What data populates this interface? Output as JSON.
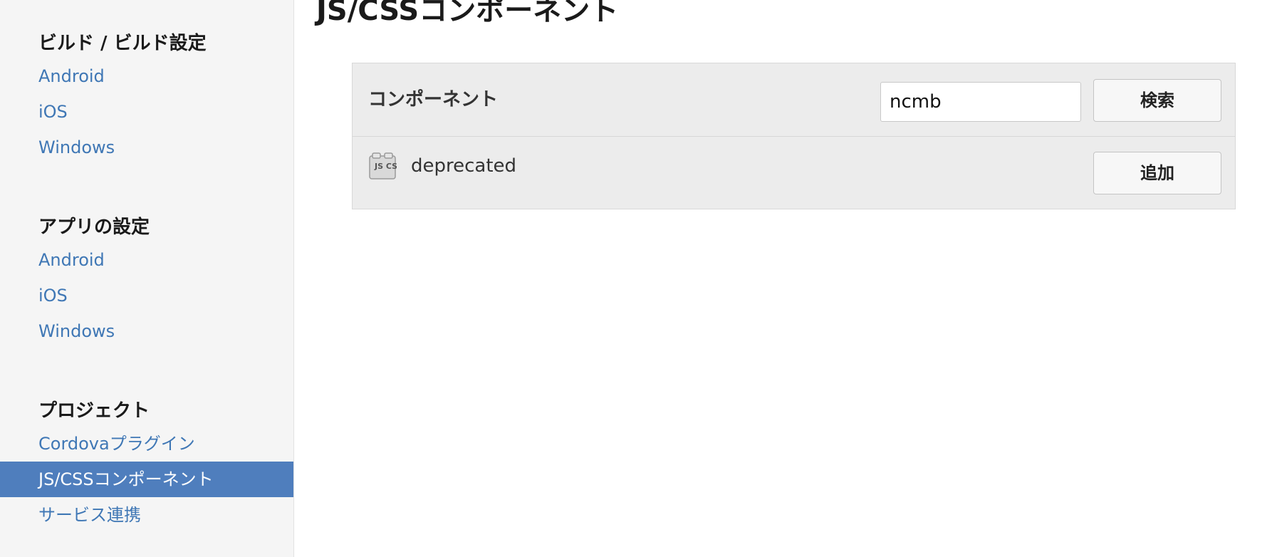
{
  "page": {
    "title": "JS/CSSコンポーネント"
  },
  "sidebar": {
    "sections": [
      {
        "title": "ビルド / ビルド設定",
        "items": [
          "Android",
          "iOS",
          "Windows"
        ]
      },
      {
        "title": "アプリの設定",
        "items": [
          "Android",
          "iOS",
          "Windows"
        ]
      },
      {
        "title": "プロジェクト",
        "items": [
          "Cordovaプラグイン",
          "JS/CSSコンポーネント",
          "サービス連携"
        ]
      }
    ],
    "active_item": "JS/CSSコンポーネント"
  },
  "components_panel": {
    "header_label": "コンポーネント",
    "search_value": "ncmb",
    "search_button": "検索",
    "results": [
      {
        "icon": "js-css-icon",
        "icon_text": "JS CSS",
        "name": "deprecated",
        "add_button": "追加"
      }
    ]
  },
  "colors": {
    "link": "#3f77b5",
    "active_bg": "#4f7ebd",
    "sidebar_bg": "#f5f5f5",
    "panel_bg": "#ececec"
  }
}
